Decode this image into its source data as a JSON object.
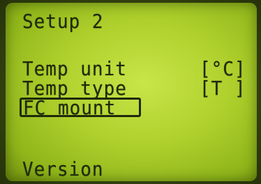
{
  "screen": {
    "title": "Setup 2",
    "items": [
      {
        "label": "Temp unit",
        "value": "[°C]"
      },
      {
        "label": "Temp type",
        "value": "[T ]"
      },
      {
        "label": "FC mount",
        "value": ""
      }
    ],
    "footer_item": "Version"
  },
  "colors": {
    "lcd_background": "#b5d631",
    "lcd_text": "#1f2a0c"
  }
}
